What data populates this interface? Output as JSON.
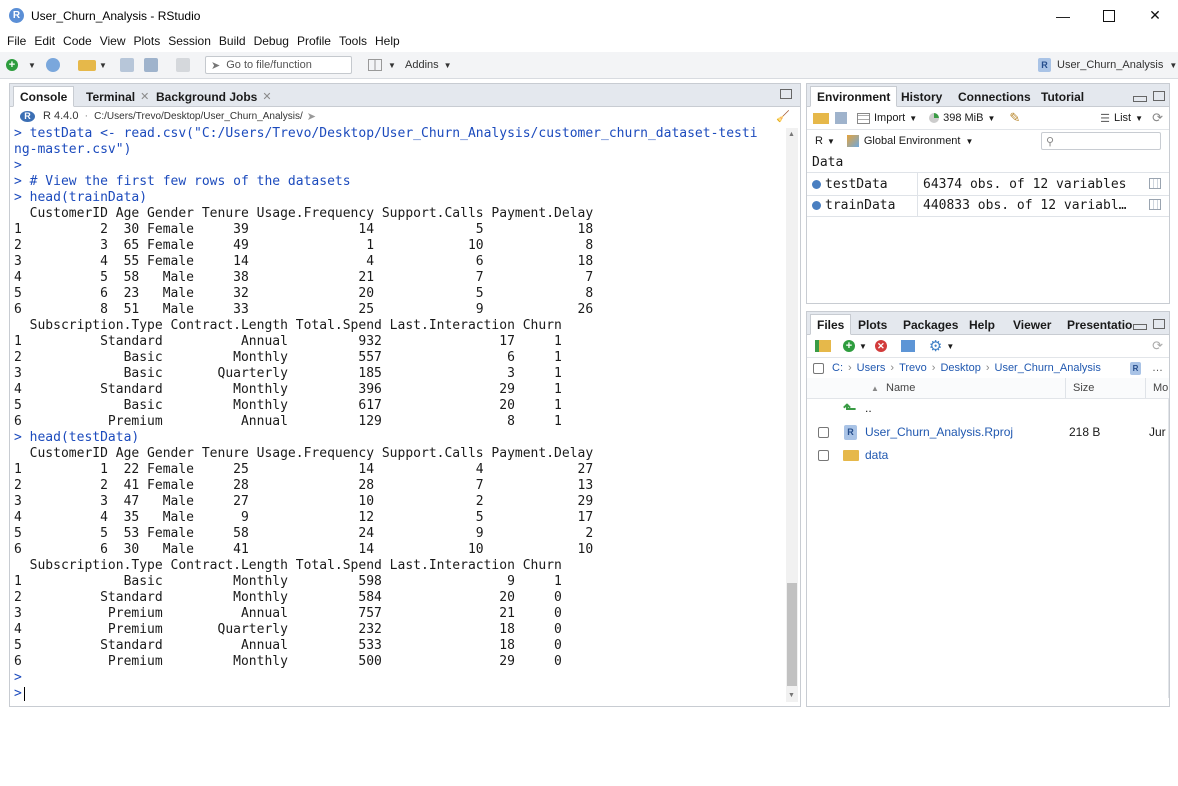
{
  "window": {
    "title": "User_Churn_Analysis - RStudio",
    "app_icon_letter": "R"
  },
  "menu": [
    "File",
    "Edit",
    "Code",
    "View",
    "Plots",
    "Session",
    "Build",
    "Debug",
    "Profile",
    "Tools",
    "Help"
  ],
  "toolbar": {
    "goto_placeholder": "Go to file/function",
    "addins_label": "Addins",
    "project_label": "User_Churn_Analysis"
  },
  "console_pane": {
    "tabs": [
      {
        "label": "Console"
      },
      {
        "label": "Terminal"
      },
      {
        "label": "Background Jobs"
      }
    ],
    "r_version": "R 4.4.0",
    "path": "C:/Users/Trevo/Desktop/User_Churn_Analysis/",
    "lines": [
      {
        "t": "> testData <- read.csv(\"C:/Users/Trevo/Desktop/User_Churn_Analysis/customer_churn_dataset-testi",
        "k": "cmd"
      },
      {
        "t": "ng-master.csv\")",
        "k": "cmd"
      },
      {
        "t": ">",
        "k": "cmd"
      },
      {
        "t": "> # View the first few rows of the datasets",
        "k": "cmd"
      },
      {
        "t": "> head(trainData)",
        "k": "cmd"
      },
      {
        "t": "  CustomerID Age Gender Tenure Usage.Frequency Support.Calls Payment.Delay",
        "k": "out"
      },
      {
        "t": "1          2  30 Female     39              14             5            18",
        "k": "out"
      },
      {
        "t": "2          3  65 Female     49               1            10             8",
        "k": "out"
      },
      {
        "t": "3          4  55 Female     14               4             6            18",
        "k": "out"
      },
      {
        "t": "4          5  58   Male     38              21             7             7",
        "k": "out"
      },
      {
        "t": "5          6  23   Male     32              20             5             8",
        "k": "out"
      },
      {
        "t": "6          8  51   Male     33              25             9            26",
        "k": "out"
      },
      {
        "t": "  Subscription.Type Contract.Length Total.Spend Last.Interaction Churn",
        "k": "out"
      },
      {
        "t": "1          Standard          Annual         932               17     1",
        "k": "out"
      },
      {
        "t": "2             Basic         Monthly         557                6     1",
        "k": "out"
      },
      {
        "t": "3             Basic       Quarterly         185                3     1",
        "k": "out"
      },
      {
        "t": "4          Standard         Monthly         396               29     1",
        "k": "out"
      },
      {
        "t": "5             Basic         Monthly         617               20     1",
        "k": "out"
      },
      {
        "t": "6           Premium          Annual         129                8     1",
        "k": "out"
      },
      {
        "t": "> head(testData)",
        "k": "cmd"
      },
      {
        "t": "  CustomerID Age Gender Tenure Usage.Frequency Support.Calls Payment.Delay",
        "k": "out"
      },
      {
        "t": "1          1  22 Female     25              14             4            27",
        "k": "out"
      },
      {
        "t": "2          2  41 Female     28              28             7            13",
        "k": "out"
      },
      {
        "t": "3          3  47   Male     27              10             2            29",
        "k": "out"
      },
      {
        "t": "4          4  35   Male      9              12             5            17",
        "k": "out"
      },
      {
        "t": "5          5  53 Female     58              24             9             2",
        "k": "out"
      },
      {
        "t": "6          6  30   Male     41              14            10            10",
        "k": "out"
      },
      {
        "t": "  Subscription.Type Contract.Length Total.Spend Last.Interaction Churn",
        "k": "out"
      },
      {
        "t": "1             Basic         Monthly         598                9     1",
        "k": "out"
      },
      {
        "t": "2          Standard         Monthly         584               20     0",
        "k": "out"
      },
      {
        "t": "3           Premium          Annual         757               21     0",
        "k": "out"
      },
      {
        "t": "4           Premium       Quarterly         232               18     0",
        "k": "out"
      },
      {
        "t": "5          Standard          Annual         533               18     0",
        "k": "out"
      },
      {
        "t": "6           Premium         Monthly         500               29     0",
        "k": "out"
      },
      {
        "t": ">",
        "k": "cmd"
      },
      {
        "t": "> ",
        "k": "cmd"
      }
    ]
  },
  "env_pane": {
    "tabs": [
      {
        "label": "Environment"
      },
      {
        "label": "History"
      },
      {
        "label": "Connections"
      },
      {
        "label": "Tutorial"
      }
    ],
    "import_label": "Import",
    "memory_label": "398 MiB",
    "list_label": "List",
    "lang_label": "R",
    "scope_label": "Global Environment",
    "section_header": "Data",
    "rows": [
      {
        "name": "testData",
        "value": "64374 obs. of 12 variables"
      },
      {
        "name": "trainData",
        "value": "440833 obs. of 12 variabl…"
      }
    ]
  },
  "files_pane": {
    "tabs": [
      {
        "label": "Files"
      },
      {
        "label": "Plots"
      },
      {
        "label": "Packages"
      },
      {
        "label": "Help"
      },
      {
        "label": "Viewer"
      },
      {
        "label": "Presentatio"
      }
    ],
    "breadcrumb": [
      "C:",
      "Users",
      "Trevo",
      "Desktop",
      "User_Churn_Analysis"
    ],
    "columns": {
      "name": "Name",
      "size": "Size",
      "modified": "Mo"
    },
    "parent_label": "..",
    "files": [
      {
        "name": "User_Churn_Analysis.Rproj",
        "size": "218 B",
        "modified": "Jur"
      },
      {
        "name": "data",
        "size": "",
        "modified": ""
      }
    ]
  },
  "colors": {
    "accent": "#4a7fc1",
    "command_text": "#1c4bbd",
    "tab_strip": "#e4e8ee"
  }
}
